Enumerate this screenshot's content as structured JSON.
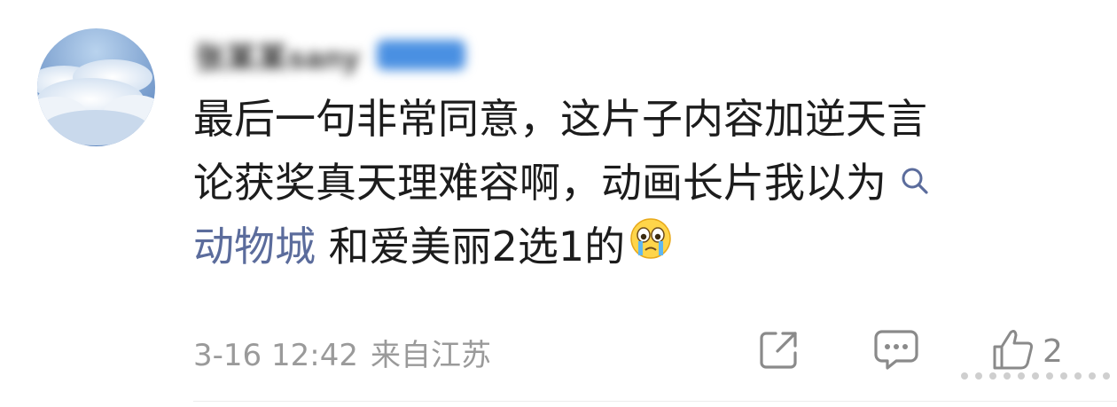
{
  "comment": {
    "username": "张某某sany",
    "badge": "",
    "lines": [
      "最后一句非常同意，这片子内容加逆天言",
      "论获奖真天理难容啊，动画长片我以为"
    ],
    "topic_link": "动物城",
    "line3_text": " 和爱美丽2选1的",
    "emoji": "crying-face",
    "timestamp": "3-16 12:42",
    "location": "来自江苏",
    "like_count": "2"
  },
  "colors": {
    "text": "#1c1c1c",
    "meta": "#9a9a9a",
    "topic_link": "#5b6c9c",
    "icon": "#8a8a8a"
  },
  "icons": {
    "search": "search-icon",
    "share": "share-icon",
    "reply": "comment-icon",
    "like": "thumbs-up-icon"
  }
}
